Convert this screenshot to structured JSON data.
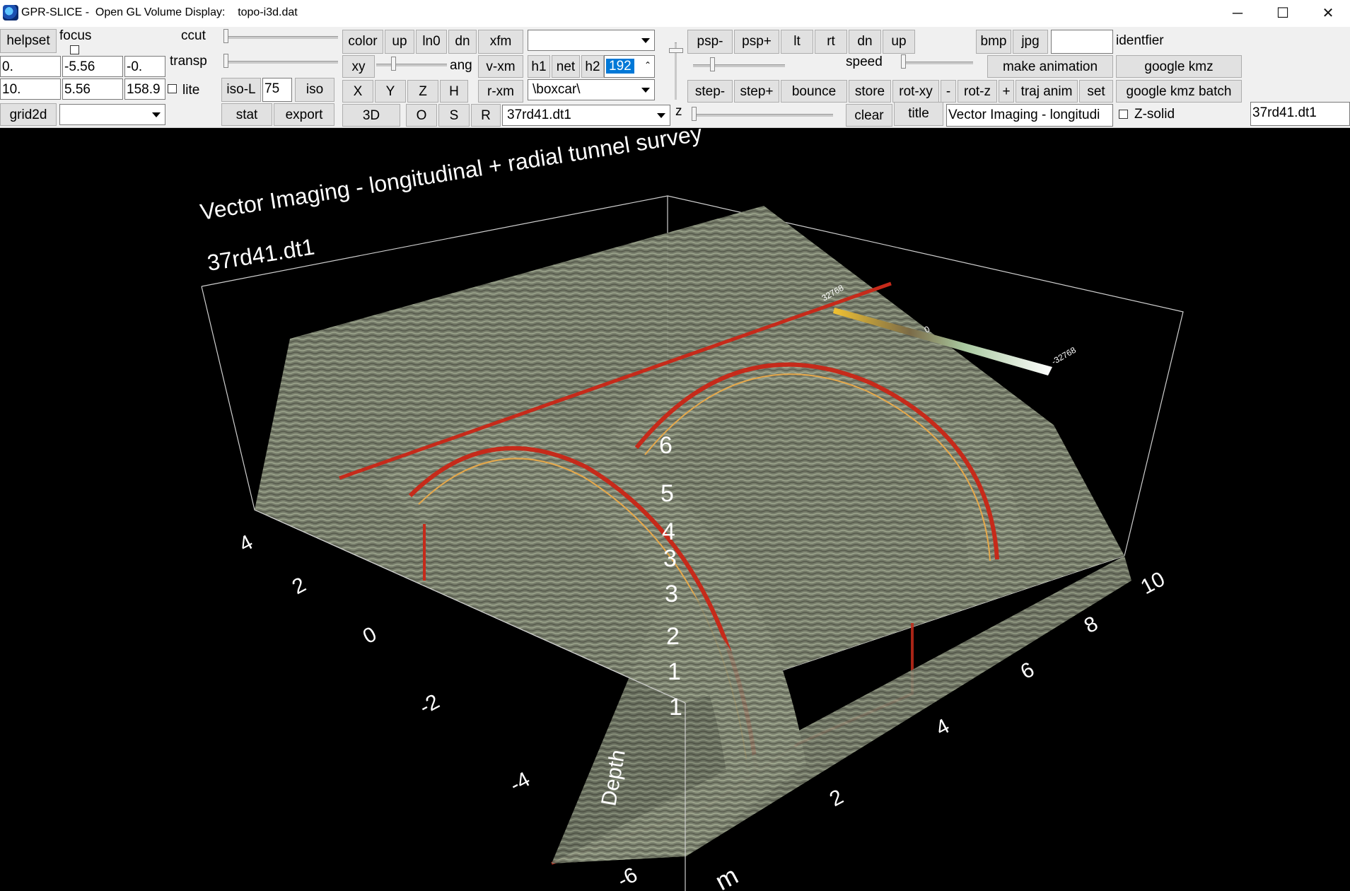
{
  "window": {
    "title": "GPR-SLICE -  Open GL Volume Display:    topo-i3d.dat",
    "minimize": "─",
    "maximize": "☐",
    "close": "✕"
  },
  "toolbar": {
    "helpset": "helpset",
    "focus": "focus",
    "ccut": "ccut",
    "transp": "transp",
    "lite": "lite",
    "grid2d": "grid2d",
    "grid2d_value": "",
    "fields": {
      "r1c1": "0.",
      "r1c2": "-5.56",
      "r1c3": "-0.",
      "r2c1": "10.",
      "r2c2": "5.56",
      "r2c3": "158.9"
    },
    "iso_l": "iso-L",
    "iso_l_value": "75",
    "iso": "iso",
    "stat": "stat",
    "export": "export",
    "color": "color",
    "up": "up",
    "ln0": "ln0",
    "dn": "dn",
    "xfm": "xfm",
    "xy": "xy",
    "ang": "ang",
    "v_xm": "v-xm",
    "x": "X",
    "y": "Y",
    "z": "Z",
    "h": "H",
    "r_xm": "r-xm",
    "three_d": "3D",
    "o": "O",
    "s": "S",
    "r": "R",
    "file_combo": "37rd41.dt1",
    "top_combo": "",
    "h1": "h1",
    "net": "net",
    "h2": "h2",
    "h2_value": "192",
    "filter_combo": "\\boxcar\\",
    "z_label": "z",
    "psp_minus": "psp-",
    "psp_plus": "psp+",
    "lt": "lt",
    "rt": "rt",
    "dn2": "dn",
    "up2": "up",
    "speed": "speed",
    "step_minus": "step-",
    "step_plus": "step+",
    "bounce": "bounce",
    "store": "store",
    "rot_xy": "rot-xy",
    "minus": "-",
    "rot_z": "rot-z",
    "plus": "+",
    "traj_anim": "traj anim",
    "set": "set",
    "clear": "clear",
    "title_btn": "title",
    "title_field": "Vector Imaging - longitudi",
    "bmp": "bmp",
    "jpg": "jpg",
    "identfier_field": "",
    "identfier": "identfier",
    "make_animation": "make animation",
    "google_kmz": "google kmz",
    "google_kmz_batch": "google kmz batch",
    "z_solid": "Z-solid",
    "file_label": "37rd41.dt1"
  },
  "scene": {
    "title": "Vector Imaging - longitudinal + radial tunnel survey",
    "subtitle": "37rd41.dt1",
    "colorbar_max": "32768",
    "colorbar_mid": "0",
    "colorbar_min": "-32768",
    "y_ticks": [
      "4",
      "2",
      "0",
      "-2",
      "-4",
      "-6"
    ],
    "x_ticks": [
      "2",
      "4",
      "6",
      "8",
      "10"
    ],
    "z_ticks": [
      "6",
      "5",
      "4",
      "3",
      "3",
      "2",
      "1",
      "1"
    ],
    "z_axis_label": "Depth",
    "x_axis_label": "m"
  }
}
